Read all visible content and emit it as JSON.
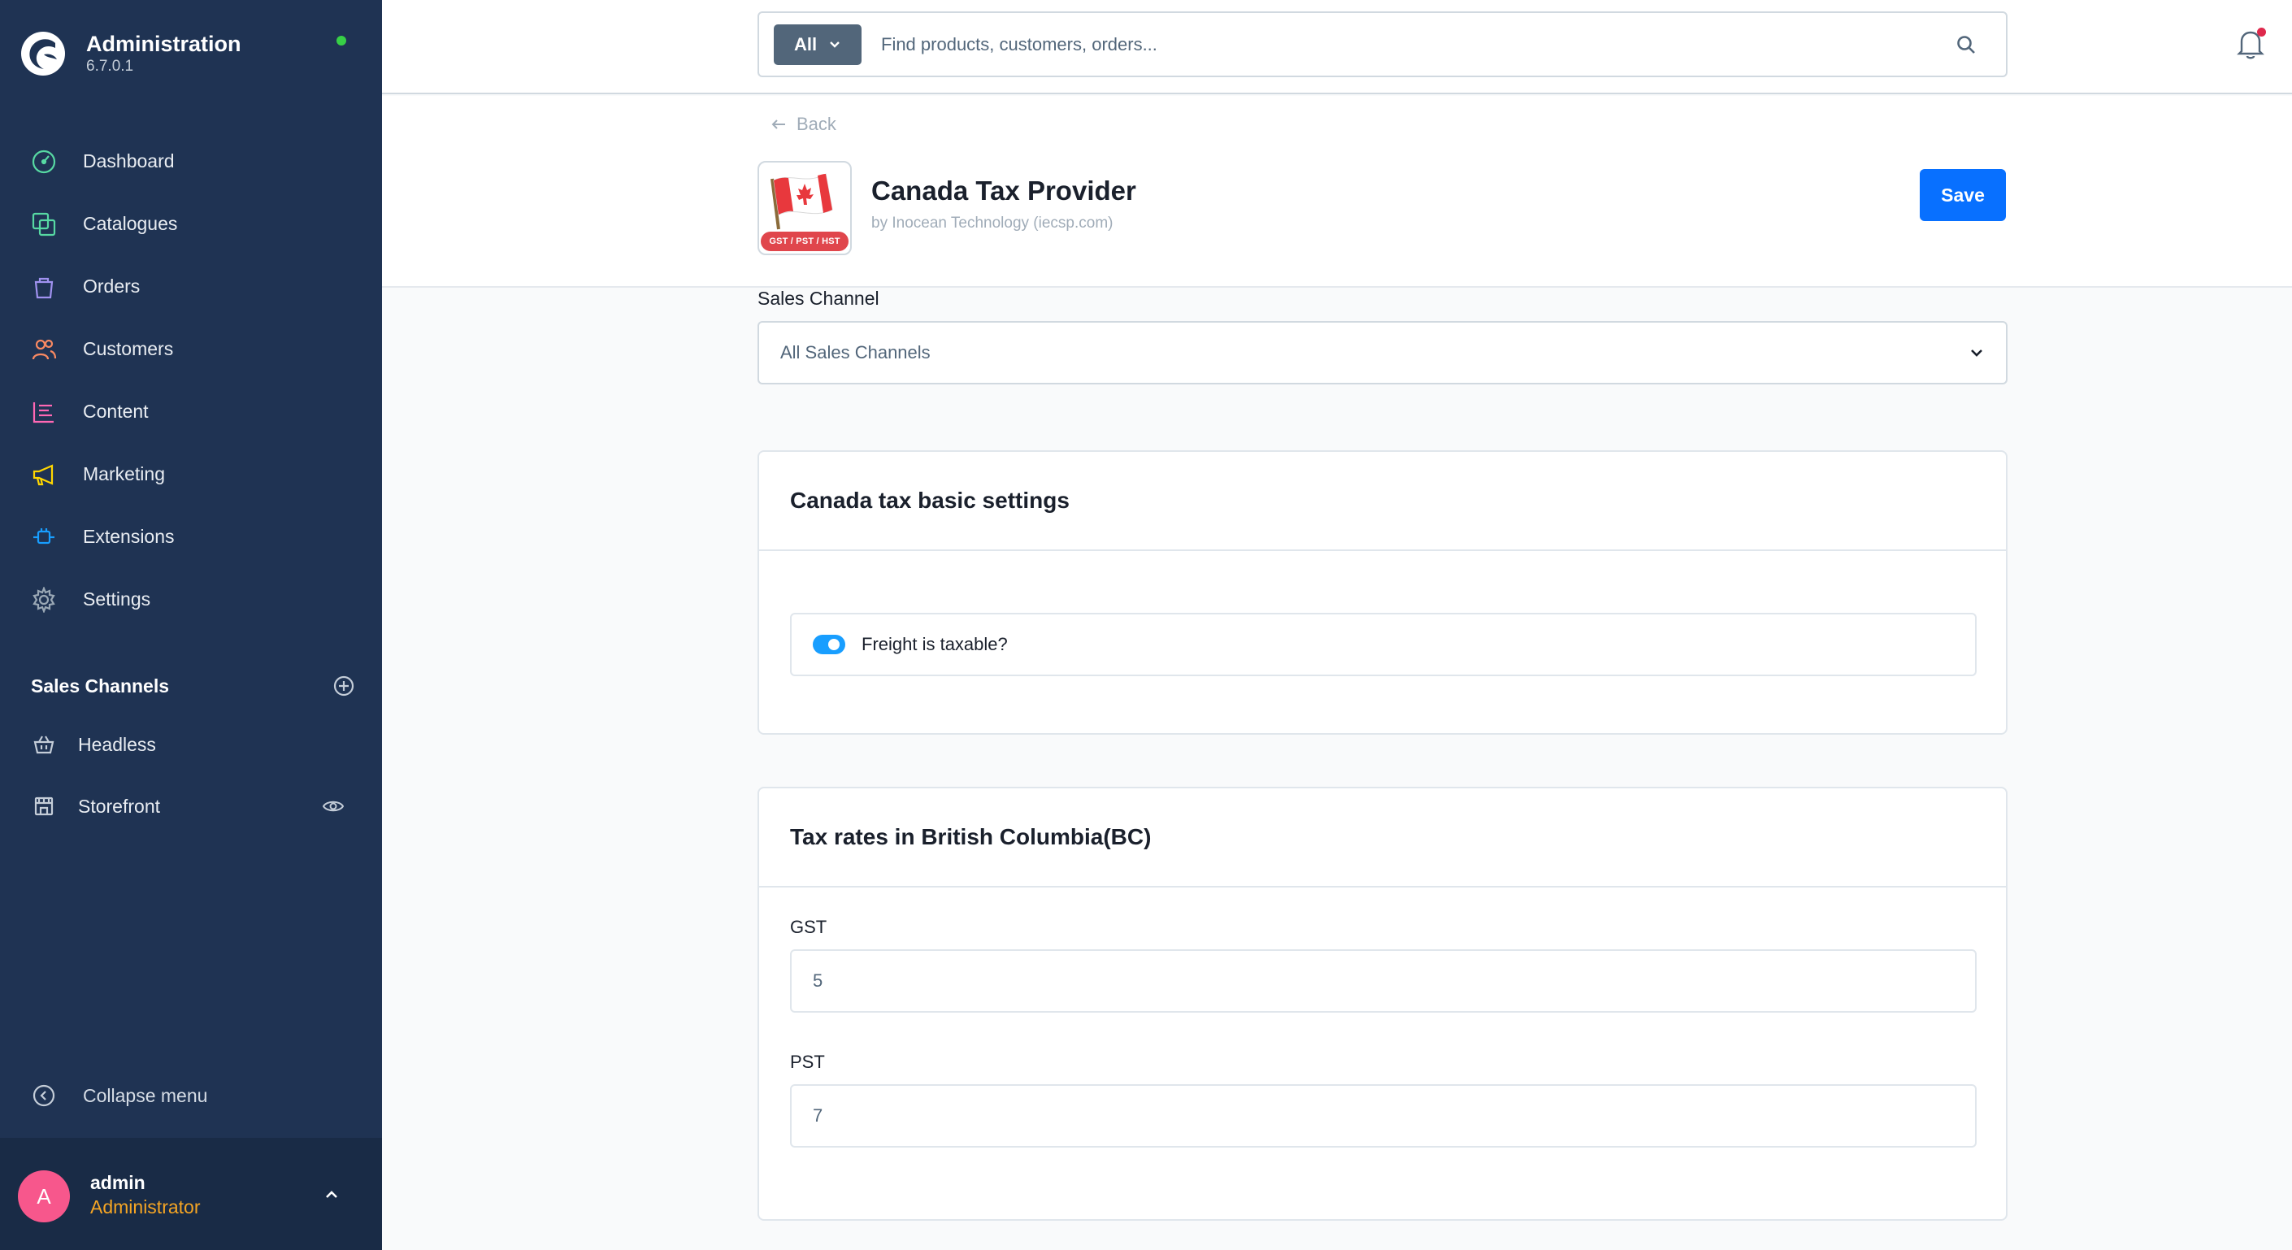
{
  "brand": {
    "title": "Administration",
    "version": "6.7.0.1"
  },
  "nav": [
    {
      "label": "Dashboard",
      "icon": "dashboard-icon",
      "color": "#57d9a3"
    },
    {
      "label": "Catalogues",
      "icon": "catalogues-icon",
      "color": "#57d9a3"
    },
    {
      "label": "Orders",
      "icon": "orders-icon",
      "color": "#a092f0"
    },
    {
      "label": "Customers",
      "icon": "customers-icon",
      "color": "#f88962"
    },
    {
      "label": "Content",
      "icon": "content-icon",
      "color": "#ff68b4"
    },
    {
      "label": "Marketing",
      "icon": "marketing-icon",
      "color": "#ffd700"
    },
    {
      "label": "Extensions",
      "icon": "extensions-icon",
      "color": "#189eff"
    },
    {
      "label": "Settings",
      "icon": "settings-icon",
      "color": "#9aa8b5"
    }
  ],
  "sales_channels": {
    "title": "Sales Channels",
    "items": [
      {
        "label": "Headless",
        "icon": "basket-icon"
      },
      {
        "label": "Storefront",
        "icon": "storefront-icon"
      }
    ]
  },
  "collapse_label": "Collapse menu",
  "user": {
    "initial": "A",
    "name": "admin",
    "role": "Administrator"
  },
  "search": {
    "type_label": "All",
    "placeholder": "Find products, customers, orders..."
  },
  "header": {
    "back_label": "Back",
    "app_title": "Canada Tax Provider",
    "app_author": "by Inocean Technology (iecsp.com)",
    "app_badge": "GST / PST / HST",
    "save_label": "Save"
  },
  "sales_channel_field": {
    "label": "Sales Channel",
    "value": "All Sales Channels"
  },
  "basic_settings": {
    "title": "Canada tax basic settings",
    "freight_label": "Freight is taxable?",
    "freight_enabled": true
  },
  "bc_rates": {
    "title": "Tax rates in British Columbia(BC)",
    "gst_label": "GST",
    "gst_value": "5",
    "pst_label": "PST",
    "pst_value": "7"
  },
  "colors": {
    "sidebar": "#1f3353",
    "accent": "#0870ff",
    "toggle": "#189eff",
    "role": "#f5a524"
  }
}
